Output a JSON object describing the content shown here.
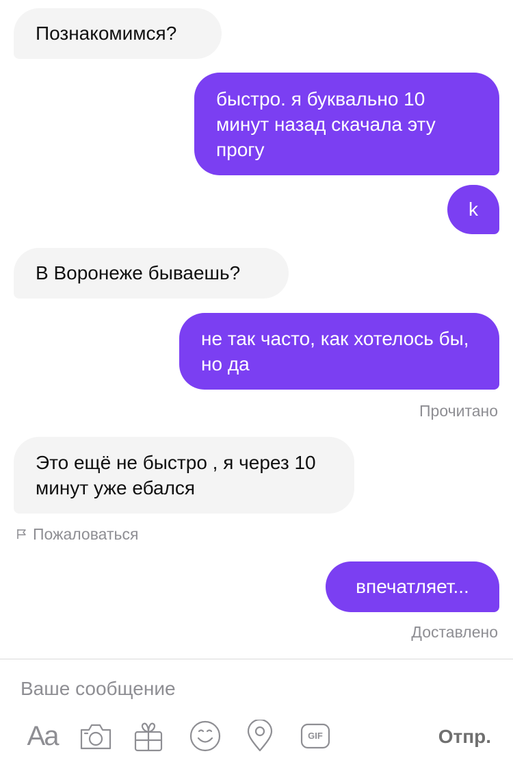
{
  "messages": [
    {
      "direction": "in",
      "text": "Познакомимся?"
    },
    {
      "direction": "out",
      "text": "быстро. я буквально 10 минут назад скачала эту прогу"
    },
    {
      "direction": "out",
      "text": "k"
    },
    {
      "direction": "in",
      "text": "В Воронеже бываешь?"
    },
    {
      "direction": "out",
      "text": "не так часто, как хотелось бы, но да"
    },
    {
      "direction": "in",
      "text": "Это ещё не быстро , я через 10 минут уже ебался"
    },
    {
      "direction": "out",
      "text": "впечатляет..."
    }
  ],
  "status_read": "Прочитано",
  "report_link": "Пожаловаться",
  "status_delivered": "Доставлено",
  "composer": {
    "placeholder": "Ваше сообщение",
    "send_label": "Отпр."
  },
  "toolbar": {
    "font_label": "Aa",
    "gif_label": "GIF",
    "icons": [
      "text-format-icon",
      "camera-icon",
      "gift-icon",
      "emoji-icon",
      "location-icon",
      "gif-icon"
    ]
  },
  "colors": {
    "outgoing_bubble": "#7b3ff2",
    "incoming_bubble": "#f4f4f4",
    "meta_text": "#8e8e93"
  }
}
